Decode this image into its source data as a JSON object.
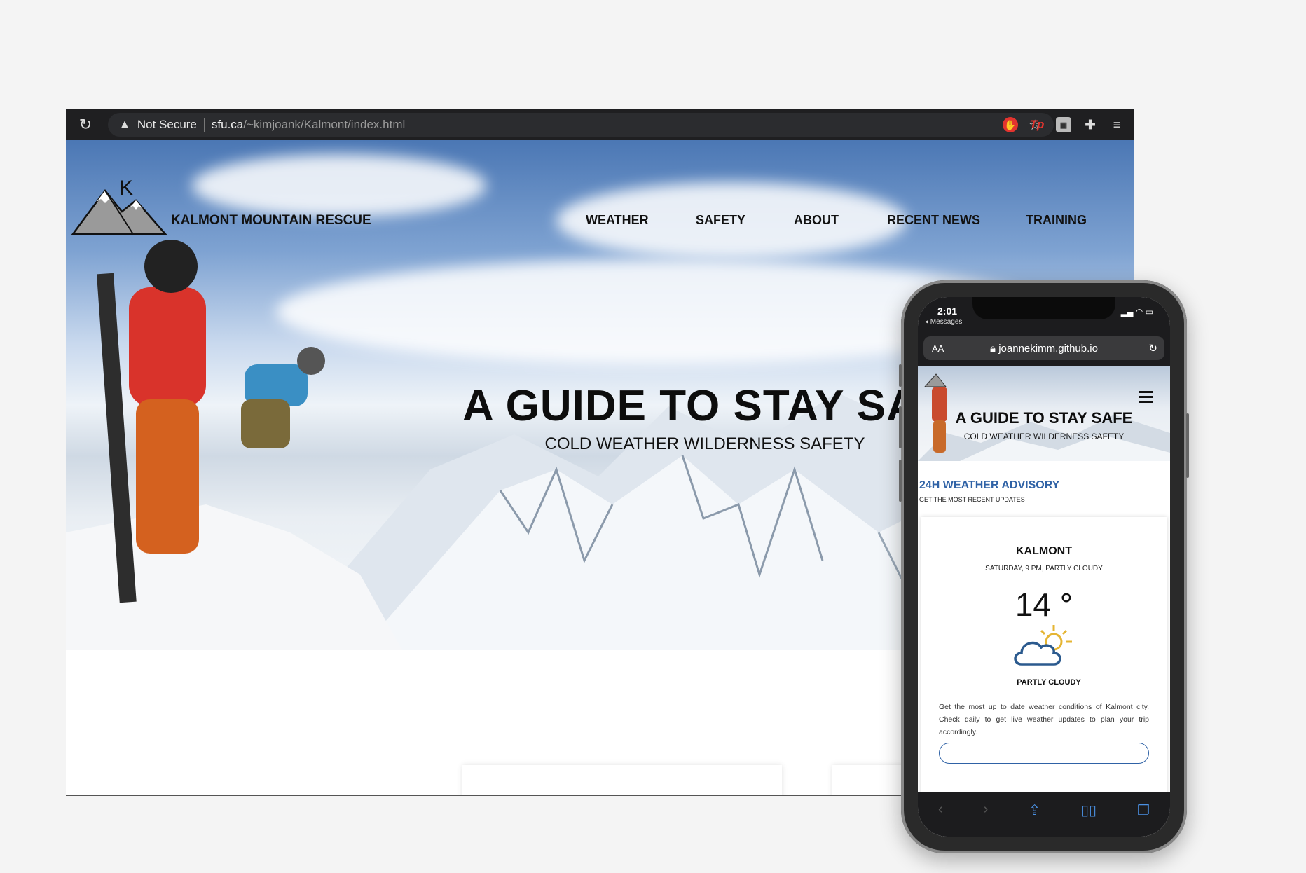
{
  "desktop": {
    "browser": {
      "security_label": "Not Secure",
      "url_host": "sfu.ca",
      "url_path": "/~kimjoank/Kalmont/index.html",
      "extension_2_text": "Tp"
    },
    "site": {
      "logo_letter": "K",
      "name": "KALMONT MOUNTAIN RESCUE",
      "nav": [
        "WEATHER",
        "SAFETY",
        "ABOUT",
        "RECENT NEWS",
        "TRAINING"
      ],
      "hero_title": "A GUIDE TO STAY SAFE",
      "hero_subtitle": "COLD WEATHER WILDERNESS SAFETY"
    }
  },
  "phone": {
    "status": {
      "time": "2:01",
      "back_label": "◂ Messages"
    },
    "browser": {
      "text_size_label": "AA",
      "url": "joannekimm.github.io"
    },
    "site": {
      "hero_title": "A GUIDE TO STAY SAFE",
      "hero_subtitle": "COLD WEATHER WILDERNESS SAFETY",
      "advisory_title": "24H WEATHER ADVISORY",
      "advisory_subtitle": "GET THE MOST RECENT UPDATES"
    },
    "weather": {
      "city": "KALMONT",
      "conditions": "SATURDAY, 9 PM, PARTLY CLOUDY",
      "temperature": "14 °",
      "icon": "partly-cloudy-icon",
      "label": "PARTLY CLOUDY",
      "description": "Get the most up to date weather conditions of Kalmont city. Check daily to get live weather updates to plan your trip accordingly."
    }
  },
  "colors": {
    "accent_blue": "#2f62a6",
    "sun_yellow": "#e5b533",
    "toolbar_dark": "#1f1f21"
  }
}
